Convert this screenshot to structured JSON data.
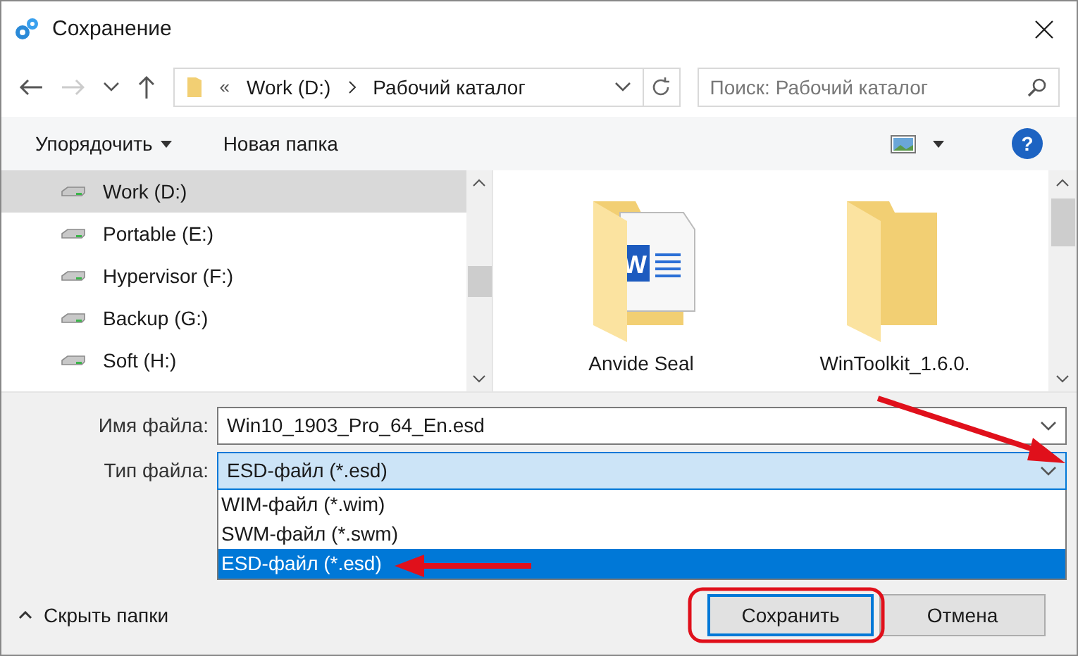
{
  "window": {
    "title": "Сохранение"
  },
  "address_bar": {
    "overflow": "«",
    "crumbs": [
      "Work (D:)",
      "Рабочий каталог"
    ]
  },
  "search": {
    "placeholder": "Поиск: Рабочий каталог"
  },
  "toolbar": {
    "organize": "Упорядочить",
    "new_folder": "Новая папка",
    "help": "?"
  },
  "sidebar": {
    "items": [
      {
        "label": "Work (D:)",
        "selected": true
      },
      {
        "label": "Portable (E:)",
        "selected": false
      },
      {
        "label": "Hypervisor (F:)",
        "selected": false
      },
      {
        "label": "Backup (G:)",
        "selected": false
      },
      {
        "label": "Soft (H:)",
        "selected": false
      }
    ]
  },
  "files": [
    {
      "name": "Anvide Seal",
      "kind": "word-folder",
      "badge": "W"
    },
    {
      "name": "WinToolkit_1.6.0.",
      "kind": "folder"
    }
  ],
  "file_name": {
    "label": "Имя файла:",
    "value": "Win10_1903_Pro_64_En.esd"
  },
  "file_type": {
    "label": "Тип файла:",
    "value": "ESD-файл (*.esd)",
    "expanded": true,
    "options": [
      {
        "label": "WIM-файл (*.wim)",
        "selected": false
      },
      {
        "label": "SWM-файл (*.swm)",
        "selected": false
      },
      {
        "label": "ESD-файл (*.esd)",
        "selected": true
      }
    ]
  },
  "hide_folders": "Скрыть папки",
  "buttons": [
    {
      "label": "Сохранить",
      "kind": "primary"
    },
    {
      "label": "Отмена",
      "kind": "secondary"
    }
  ]
}
